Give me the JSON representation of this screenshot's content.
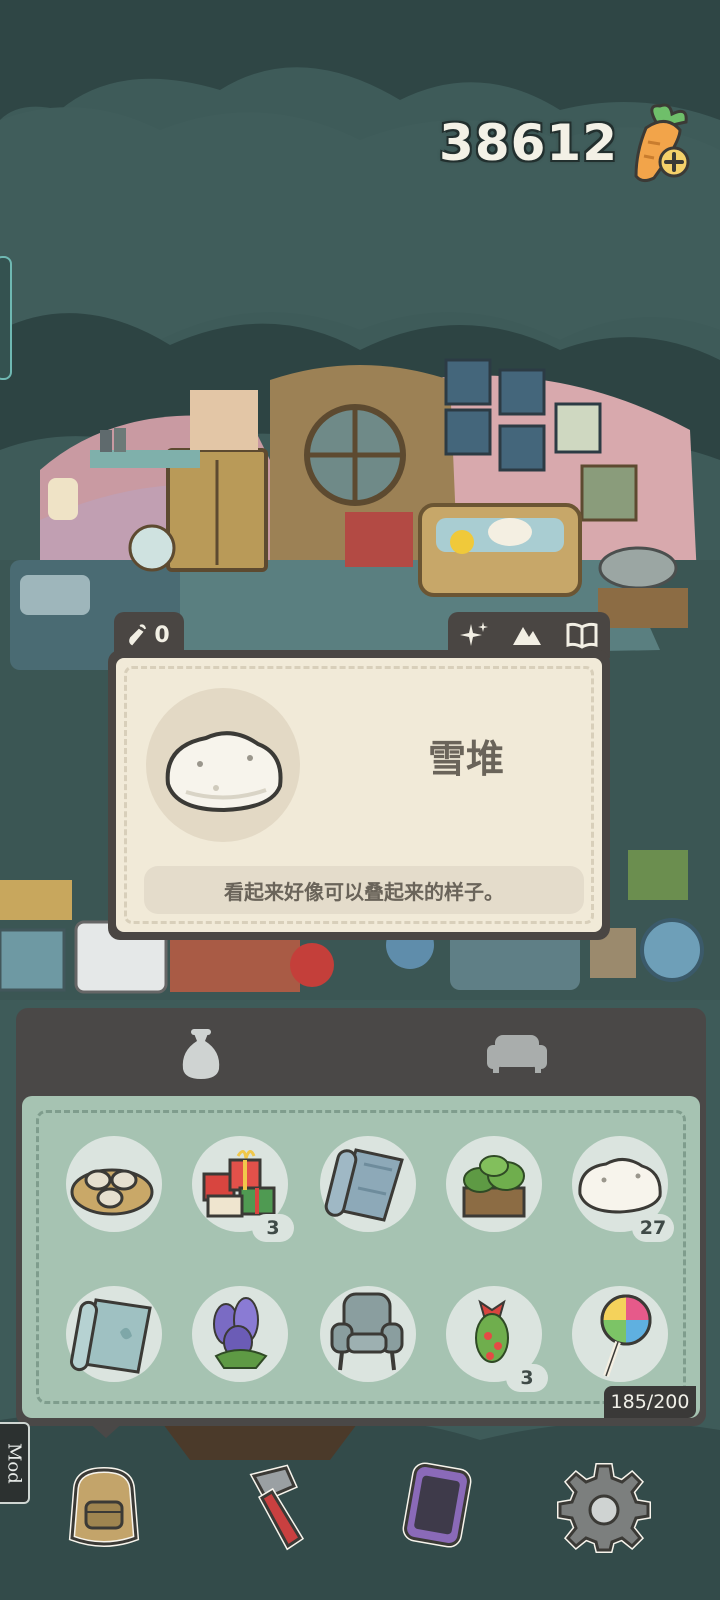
{
  "currency": {
    "amount": "38612",
    "icon": "carrot-plus-icon"
  },
  "item_card": {
    "price": "0",
    "name": "雪堆",
    "description": "看起来好像可以叠起来的样子。",
    "actions": [
      "sparkle-icon",
      "mountain-icon",
      "book-icon"
    ]
  },
  "inventory": {
    "tabs": [
      "bag-tab-icon",
      "sofa-tab-icon"
    ],
    "items": [
      {
        "icon": "tea-tray-icon",
        "count": ""
      },
      {
        "icon": "gift-boxes-icon",
        "count": "3"
      },
      {
        "icon": "rolled-rug-icon",
        "count": ""
      },
      {
        "icon": "planter-box-icon",
        "count": ""
      },
      {
        "icon": "snow-pile-icon",
        "count": "27"
      },
      {
        "icon": "leaf-wallpaper-icon",
        "count": ""
      },
      {
        "icon": "lavender-icon",
        "count": ""
      },
      {
        "icon": "armchair-icon",
        "count": ""
      },
      {
        "icon": "holly-wreath-icon",
        "count": "3"
      },
      {
        "icon": "lollipop-icon",
        "count": ""
      }
    ],
    "capacity": "185/200"
  },
  "mod_label": "Mod",
  "bottom_nav": [
    "backpack-icon",
    "hammer-icon",
    "phone-icon",
    "settings-gear-icon"
  ]
}
